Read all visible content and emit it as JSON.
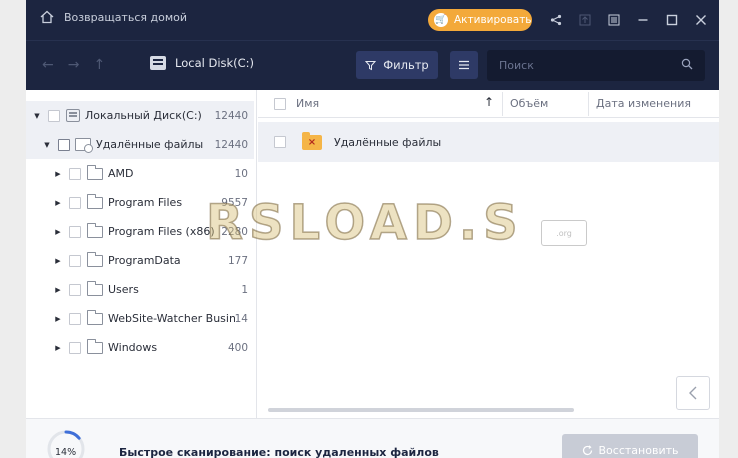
{
  "titlebar": {
    "home_label": "Возвращаться домой",
    "activate_label": "Активировать",
    "icons": [
      "share-icon",
      "upload-icon",
      "menu-icon",
      "minimize-icon",
      "maximize-icon",
      "close-icon"
    ]
  },
  "toolbar": {
    "disk_label": "Local Disk(C:)",
    "filter_label": "Фильтр",
    "search_placeholder": "Поиск"
  },
  "tree": {
    "root": {
      "label": "Локальный Диск(C:)",
      "count": "12440"
    },
    "deleted": {
      "label": "Удалённые файлы",
      "count": "12440"
    },
    "items": [
      {
        "label": "AMD",
        "count": "10"
      },
      {
        "label": "Program Files",
        "count": "9557"
      },
      {
        "label": "Program Files (x86)",
        "count": "2280"
      },
      {
        "label": "ProgramData",
        "count": "177"
      },
      {
        "label": "Users",
        "count": "1"
      },
      {
        "label": "WebSite-Watcher Busin…",
        "count": "14"
      },
      {
        "label": "Windows",
        "count": "400"
      }
    ]
  },
  "list": {
    "columns": {
      "name": "Имя",
      "size": "Объём",
      "date": "Дата изменения"
    },
    "rows": [
      {
        "name": "Удалённые файлы"
      }
    ]
  },
  "bottom": {
    "progress_pct": "14%",
    "progress_value": 0.14,
    "scan_text": "Быстрое сканирование: поиск удаленных файлов",
    "recover_label": "Восстановить"
  },
  "watermark": {
    "text": "RSLOAD.S",
    "sub": ".org"
  },
  "colors": {
    "titlebar": "#1c2540",
    "accent": "#f3a93a",
    "selection": "#eef0f5"
  }
}
